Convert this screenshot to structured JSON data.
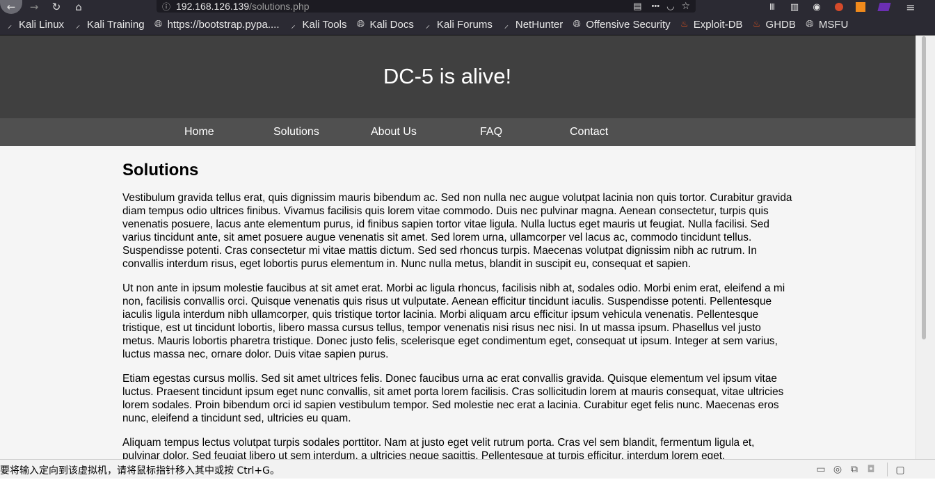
{
  "browser": {
    "url_host": "192.168.126.139",
    "url_path": "/solutions.php",
    "icons": {
      "back": "←",
      "forward": "→",
      "reload": "↻",
      "home": "⌂",
      "reader": "▤",
      "more": "•••",
      "pocket": "◡",
      "star": "☆",
      "info": "ⓘ",
      "library": "Ⅲ",
      "sidebar": "▥",
      "account": "◉",
      "menu": "≡"
    }
  },
  "bookmarks": [
    {
      "label": "Kali Linux",
      "icon": "dragon-icon"
    },
    {
      "label": "Kali Training",
      "icon": "dragon-icon"
    },
    {
      "label": "https://bootstrap.pypa....",
      "icon": "globe-icon"
    },
    {
      "label": "Kali Tools",
      "icon": "dragon-icon"
    },
    {
      "label": "Kali Docs",
      "icon": "globe-icon"
    },
    {
      "label": "Kali Forums",
      "icon": "dragon-icon"
    },
    {
      "label": "NetHunter",
      "icon": "dragon-icon"
    },
    {
      "label": "Offensive Security",
      "icon": "globe-icon"
    },
    {
      "label": "Exploit-DB",
      "icon": "fire-icon"
    },
    {
      "label": "GHDB",
      "icon": "fire-icon"
    },
    {
      "label": "MSFU",
      "icon": "globe-icon"
    }
  ],
  "site": {
    "title": "DC-5 is alive!",
    "nav": [
      "Home",
      "Solutions",
      "About Us",
      "FAQ",
      "Contact"
    ],
    "heading": "Solutions",
    "paragraphs": [
      "Vestibulum gravida tellus erat, quis dignissim mauris bibendum ac. Sed non nulla nec augue volutpat lacinia non quis tortor. Curabitur gravida diam tempus odio ultrices finibus. Vivamus facilisis quis lorem vitae commodo. Duis nec pulvinar magna. Aenean consectetur, turpis quis venenatis posuere, lacus ante elementum purus, id finibus sapien tortor vitae ligula. Nulla luctus eget mauris ut feugiat. Nulla facilisi. Sed varius tincidunt ante, sit amet posuere augue venenatis sit amet. Sed lorem urna, ullamcorper vel lacus ac, commodo tincidunt tellus. Suspendisse potenti. Cras consectetur mi vitae mattis dictum. Sed sed rhoncus turpis. Maecenas volutpat dignissim nibh ac rutrum. In convallis interdum risus, eget lobortis purus elementum in. Nunc nulla metus, blandit in suscipit eu, consequat et sapien.",
      "Ut non ante in ipsum molestie faucibus at sit amet erat. Morbi ac ligula rhoncus, facilisis nibh at, sodales odio. Morbi enim erat, eleifend a mi non, facilisis convallis orci. Quisque venenatis quis risus ut vulputate. Aenean efficitur tincidunt iaculis. Suspendisse potenti. Pellentesque iaculis ligula interdum nibh ullamcorper, quis tristique tortor lacinia. Morbi aliquam arcu efficitur ipsum vehicula venenatis. Pellentesque tristique, est ut tincidunt lobortis, libero massa cursus tellus, tempor venenatis nisi risus nec nisi. In ut massa ipsum. Phasellus vel justo metus. Mauris lobortis pharetra tristique. Donec justo felis, scelerisque eget condimentum eget, consequat ut ipsum. Integer at sem varius, luctus massa nec, ornare dolor. Duis vitae sapien purus.",
      "Etiam egestas cursus mollis. Sed sit amet ultrices felis. Donec faucibus urna ac erat convallis gravida. Quisque elementum vel ipsum vitae luctus. Praesent tincidunt ipsum eget nunc convallis, sit amet porta lorem facilisis. Cras sollicitudin lorem at mauris consequat, vitae ultricies lorem sodales. Proin bibendum orci id sapien vestibulum tempor. Sed molestie nec erat a lacinia. Curabitur eget felis nunc. Maecenas eros nunc, eleifend a tincidunt sed, ultricies eu quam.",
      "Aliquam tempus lectus volutpat turpis sodales porttitor. Nam at justo eget velit rutrum porta. Cras vel sem blandit, fermentum ligula et, pulvinar dolor. Sed feugiat libero ut sem interdum, a ultricies neque sagittis. Pellentesque at turpis efficitur, interdum lorem eget,"
    ]
  },
  "vm_status": {
    "message": "要将输入定向到该虚拟机，请将鼠标指针移入其中或按 Ctrl+G。"
  },
  "colors": {
    "header_bg": "#404040",
    "nav_bg": "#505050",
    "page_bg": "#f5f5f5",
    "browser_chrome": "#2b2a33",
    "exploit_accent": "#e0541f"
  }
}
